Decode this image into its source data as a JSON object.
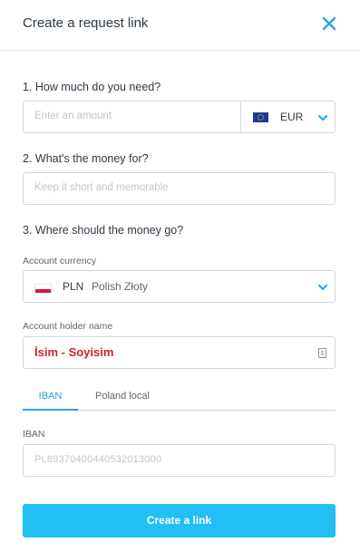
{
  "header": {
    "title": "Create a request link",
    "close_icon": "close-icon"
  },
  "amount_section": {
    "label": "1. How much do you need?",
    "placeholder": "Enter an amount",
    "currency": "EUR",
    "currency_flag_icon": "eu-flag-icon"
  },
  "purpose_section": {
    "label": "2. What's the money for?",
    "placeholder": "Keep it short and memorable"
  },
  "destination_section": {
    "label": "3. Where should the money go?",
    "account_currency_label": "Account currency",
    "account_currency_code": "PLN",
    "account_currency_name": "Polish Złoty",
    "account_currency_flag_icon": "poland-flag-icon",
    "holder_label": "Account holder name",
    "holder_value": "İsim - Soyisim",
    "tabs": [
      "IBAN",
      "Poland local"
    ],
    "active_tab": "IBAN",
    "iban_label": "IBAN",
    "iban_placeholder": "PL89370400440532013000"
  },
  "submit": {
    "label": "Create a link"
  },
  "colors": {
    "accent": "#22bff5",
    "tab_active": "#21a7e0",
    "text": "#2e3a46",
    "holder_text": "#d0202b"
  }
}
